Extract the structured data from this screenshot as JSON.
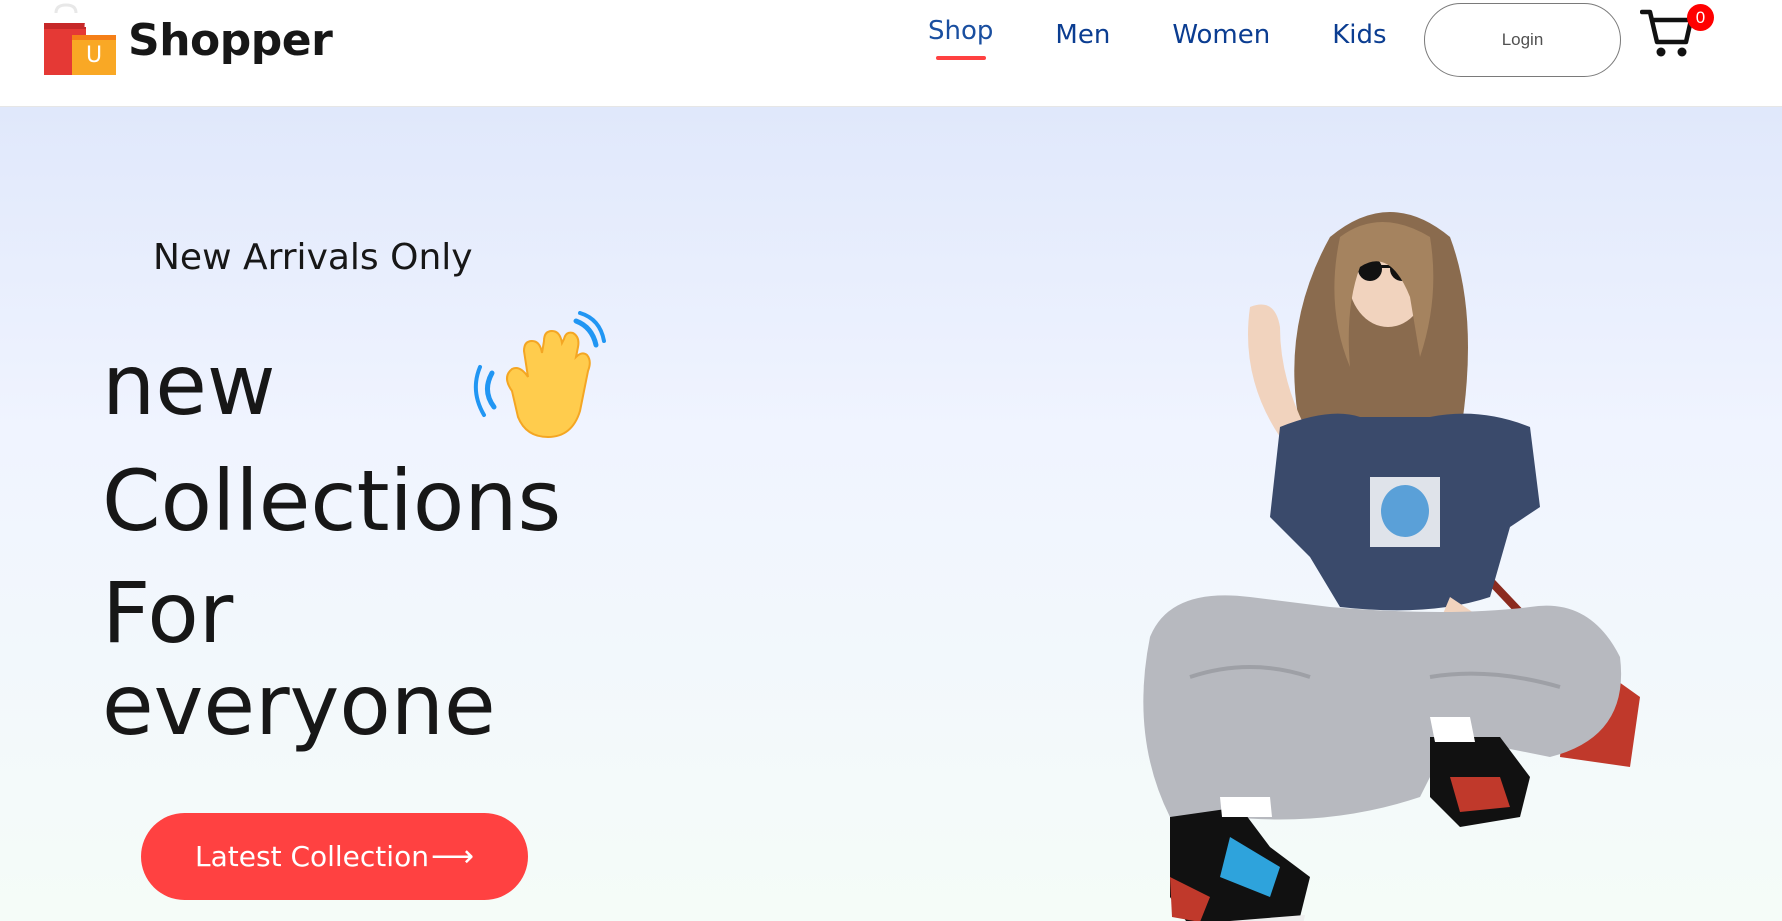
{
  "brand": {
    "name": "Shopper",
    "bag_letter": "U"
  },
  "nav": {
    "items": [
      {
        "label": "Shop",
        "active": true
      },
      {
        "label": "Men",
        "active": false
      },
      {
        "label": "Women",
        "active": false
      },
      {
        "label": "Kids",
        "active": false
      }
    ]
  },
  "header": {
    "login_label": "Login",
    "cart_count": "0"
  },
  "hero": {
    "eyebrow": "New Arrivals Only",
    "line1": "new",
    "line2": "Collections",
    "line3": "For",
    "line4": "everyone",
    "cta_label": "Latest Collection",
    "cta_arrow": "⟶"
  },
  "colors": {
    "accent": "#ff4141",
    "nav_text": "#0b3d91",
    "badge": "#ff0000",
    "text": "#171717"
  },
  "icons": [
    "shopping-bag-logo-icon",
    "cart-icon",
    "waving-hand-icon",
    "arrow-right-icon"
  ]
}
